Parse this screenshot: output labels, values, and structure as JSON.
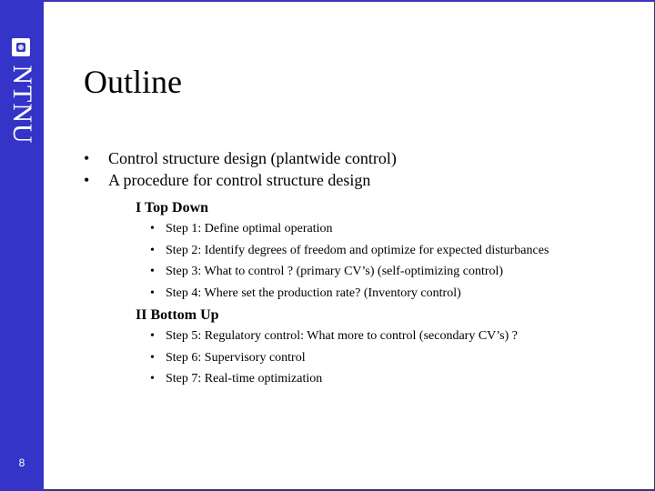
{
  "sidebar": {
    "logo_text": "NTNU",
    "page_number": "8",
    "color": "#3434c8"
  },
  "slide": {
    "title": "Outline",
    "bullets": [
      {
        "marker": "•",
        "text": "Control structure design (plantwide control)"
      },
      {
        "marker": "•",
        "text": "A procedure for control structure design"
      }
    ],
    "sections": [
      {
        "heading": "I  Top Down",
        "steps": [
          {
            "marker": "•",
            "text": "Step 1: Define optimal operation"
          },
          {
            "marker": "•",
            "text": "Step 2: Identify degrees of freedom and optimize for expected disturbances"
          },
          {
            "marker": "•",
            "text": "Step 3: What to control ? (primary CV’s) (self-optimizing control)"
          },
          {
            "marker": "•",
            "text": "Step 4: Where set the production rate? (Inventory control)"
          }
        ]
      },
      {
        "heading": "II Bottom Up",
        "steps": [
          {
            "marker": "•",
            "text": "Step 5: Regulatory control: What more to control (secondary CV’s) ?"
          },
          {
            "marker": "•",
            "text": "Step 6: Supervisory control"
          },
          {
            "marker": "•",
            "text": "Step 7: Real-time optimization"
          }
        ]
      }
    ]
  }
}
